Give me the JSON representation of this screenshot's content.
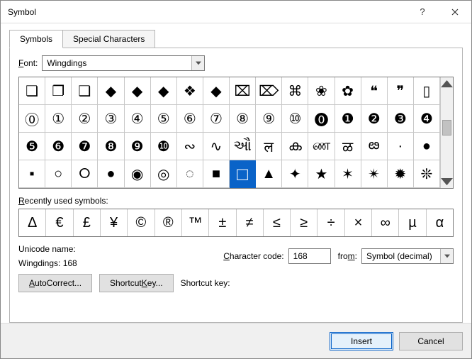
{
  "title": "Symbol",
  "tabs": {
    "symbols": "Symbols",
    "special": "Special Characters"
  },
  "font": {
    "label": "Font:",
    "value": "Wingdings"
  },
  "symbols": [
    [
      "❏",
      "❐",
      "❑",
      "◆",
      "◆",
      "◆",
      "❖",
      "◆",
      "⌧",
      "⌦",
      "⌘",
      "❀",
      "✿",
      "❝",
      "❞",
      "▯"
    ],
    [
      "⓪",
      "①",
      "②",
      "③",
      "④",
      "⑤",
      "⑥",
      "⑦",
      "⑧",
      "⑨",
      "⑩",
      "⓿",
      "❶",
      "❷",
      "❸",
      "❹"
    ],
    [
      "❺",
      "❻",
      "❼",
      "❽",
      "❾",
      "❿",
      "∾",
      "∿",
      "ઔ",
      "ल",
      "ക",
      "ண",
      "ळ",
      "ఴ",
      "·",
      "●"
    ],
    [
      "▪",
      "○",
      "⭘",
      "●",
      "◉",
      "◎",
      "◌",
      "■",
      "□",
      "▲",
      "✦",
      "★",
      "✶",
      "✴",
      "✹",
      "❊"
    ]
  ],
  "selected": {
    "row": 3,
    "col": 8
  },
  "recent_label": "Recently used symbols:",
  "recent": [
    "Δ",
    "€",
    "£",
    "¥",
    "©",
    "®",
    "™",
    "±",
    "≠",
    "≤",
    "≥",
    "÷",
    "×",
    "∞",
    "µ",
    "α"
  ],
  "unicode_name_label": "Unicode name:",
  "unicode_name_value": "Wingdings: 168",
  "char_code_label": "Character code:",
  "char_code_value": "168",
  "from_label": "from:",
  "from_value": "Symbol (decimal)",
  "buttons": {
    "autocorrect": "AutoCorrect...",
    "shortcut": "Shortcut Key...",
    "shortcut_label": "Shortcut key:",
    "insert": "Insert",
    "cancel": "Cancel"
  }
}
